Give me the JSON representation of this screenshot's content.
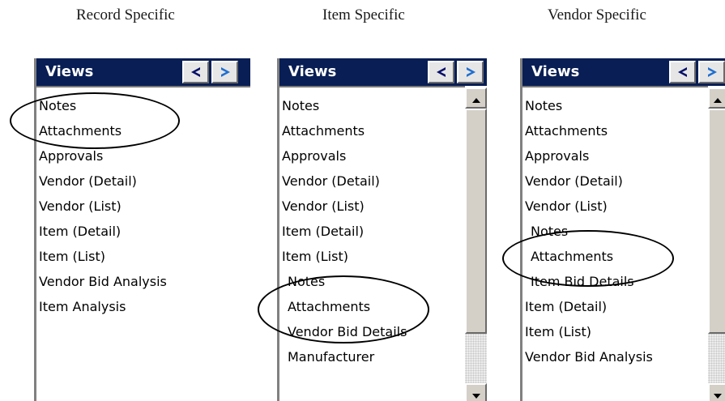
{
  "captions": {
    "record": "Record Specific",
    "item": "Item Specific",
    "vendor": "Vendor Specific"
  },
  "views_title": "Views",
  "colors": {
    "header_bg": "#081e54",
    "arrow_prev": "#06106a",
    "arrow_next": "#1f6fd0"
  },
  "icons": {
    "prev": "arrow-left-icon",
    "next": "arrow-right-icon",
    "scroll_up": "scroll-up-arrow-icon",
    "scroll_down": "scroll-down-arrow-icon"
  },
  "record_panel": {
    "items": [
      "Notes",
      "Attachments",
      "Approvals",
      "Vendor (Detail)",
      "Vendor (List)",
      "Item (Detail)",
      "Item (List)",
      "Vendor Bid Analysis",
      "Item Analysis"
    ]
  },
  "item_panel": {
    "items": [
      "Notes",
      "Attachments",
      "Approvals",
      "Vendor (Detail)",
      "Vendor (List)",
      "Item (Detail)",
      "Item (List)",
      "Notes",
      "Attachments",
      "Vendor Bid Details",
      "Manufacturer"
    ]
  },
  "vendor_panel": {
    "items": [
      "Notes",
      "Attachments",
      "Approvals",
      "Vendor (Detail)",
      "Vendor (List)",
      "Notes",
      "Attachments",
      "Item Bid Details",
      "Item (Detail)",
      "Item (List)",
      "Vendor Bid Analysis"
    ]
  }
}
